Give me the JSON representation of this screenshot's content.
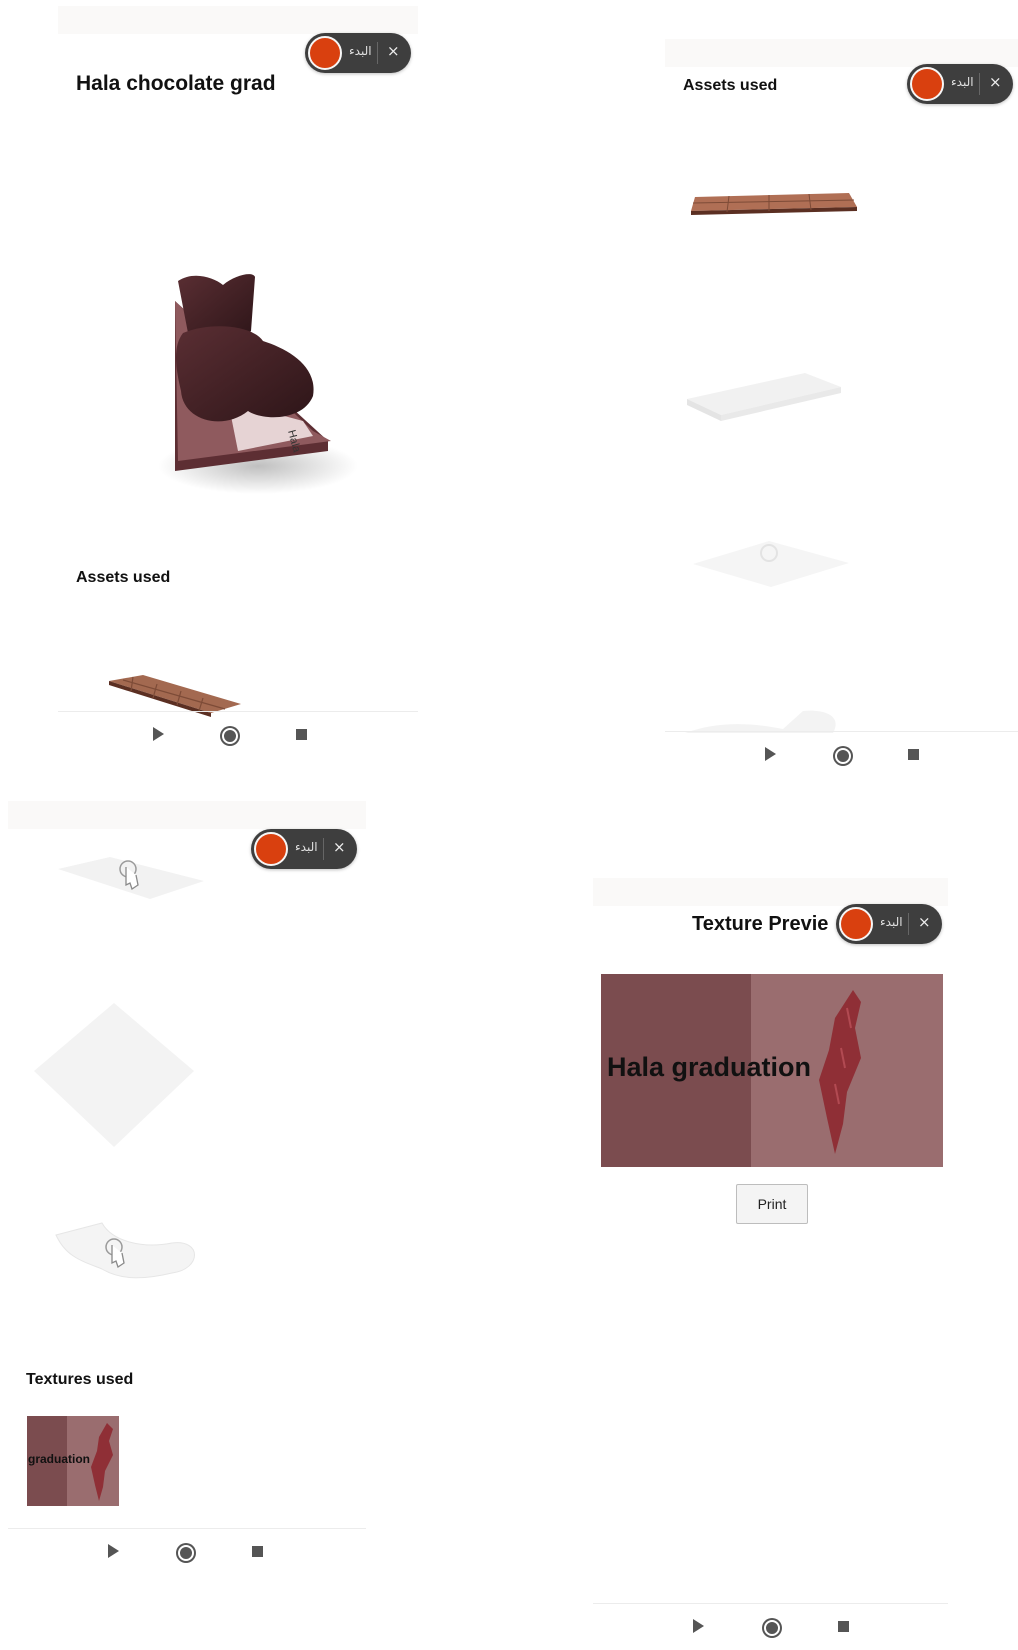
{
  "panel1": {
    "title": "Hala chocolate grad",
    "assets_heading": "Assets used",
    "model_caption": "Hala"
  },
  "panel2": {
    "title": "Assets used"
  },
  "panel3": {
    "textures_heading": "Textures used",
    "texture_text": "graduation"
  },
  "panel4": {
    "title": "Texture Previe",
    "texture_text": "Hala graduation",
    "print_label": "Print"
  },
  "recorder": {
    "label": "البدء",
    "close_glyph": "×",
    "record_color": "#d9400f"
  },
  "colors": {
    "texture_dark": "#7b4c4f",
    "texture_light": "#9a6d6f",
    "map_red": "#8f2f36"
  }
}
